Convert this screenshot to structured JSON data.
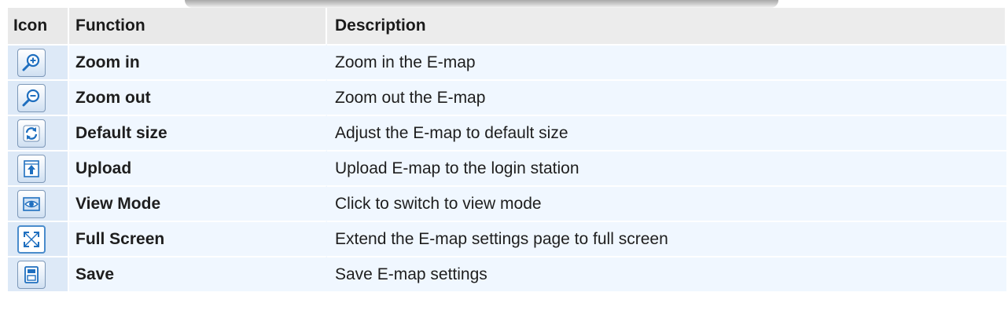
{
  "table": {
    "headers": {
      "icon": "Icon",
      "function": "Function",
      "description": "Description"
    },
    "rows": [
      {
        "icon": "zoom-in-icon",
        "function": "Zoom in",
        "description": "Zoom in the E-map"
      },
      {
        "icon": "zoom-out-icon",
        "function": "Zoom out",
        "description": "Zoom out the E-map"
      },
      {
        "icon": "default-size-icon",
        "function": "Default size",
        "description": "Adjust the E-map to default size"
      },
      {
        "icon": "upload-icon",
        "function": "Upload",
        "description": "Upload E-map to the login station"
      },
      {
        "icon": "view-mode-icon",
        "function": "View Mode",
        "description": "Click to switch to view mode"
      },
      {
        "icon": "full-screen-icon",
        "function": "Full Screen",
        "description": "Extend the E-map settings page to full screen"
      },
      {
        "icon": "save-icon",
        "function": "Save",
        "description": "Save E-map settings"
      }
    ]
  },
  "colors": {
    "header_bg": "#e9e9e9",
    "row_bg": "#f0f7ff",
    "icon_cell_bg": "#dde9f7",
    "icon_accent": "#1f6fbf"
  }
}
